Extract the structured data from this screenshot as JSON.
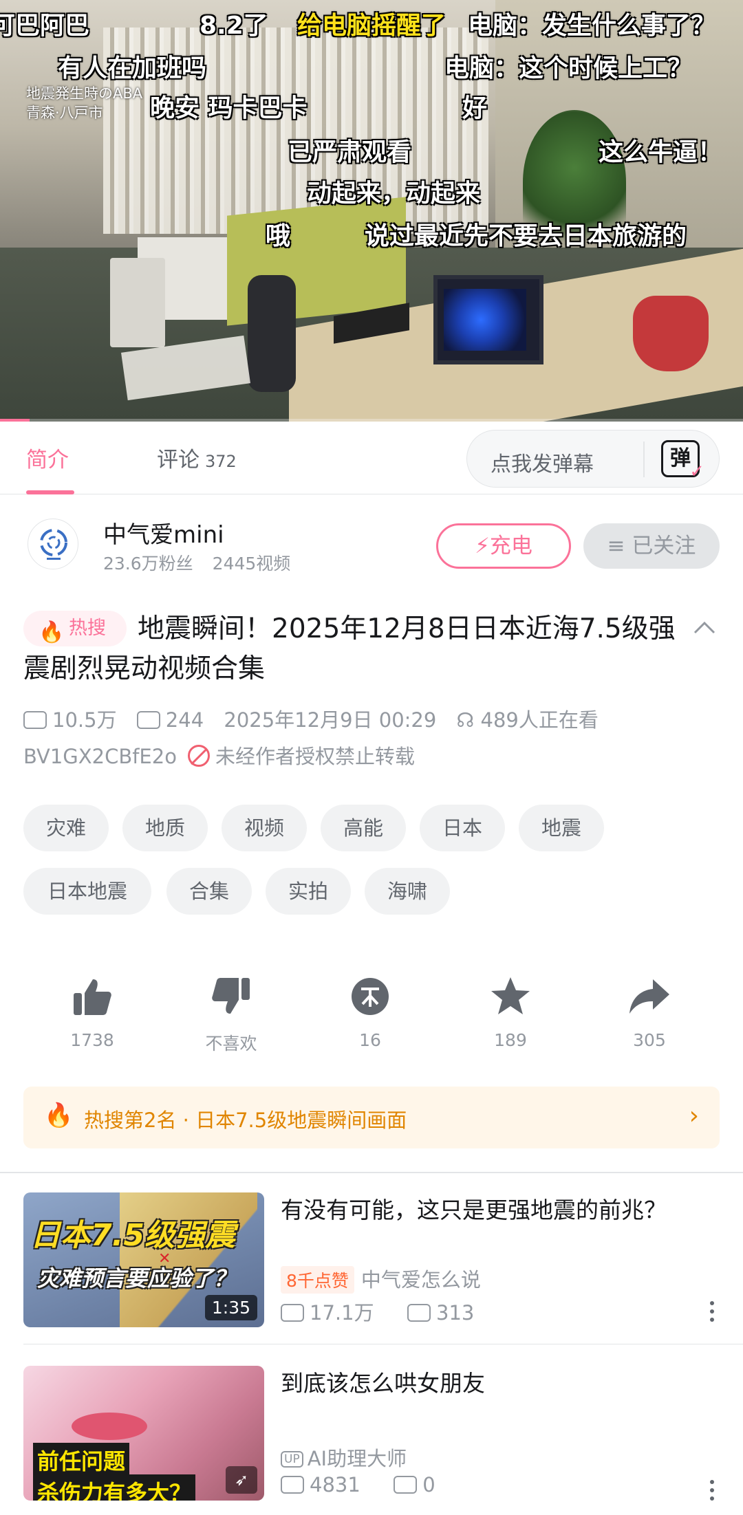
{
  "player": {
    "tv_caption_line1": "地震発生時のABA",
    "tv_caption_line2": "青森·八戸市",
    "danmaku": [
      {
        "text": "可巴阿巴",
        "color": "white"
      },
      {
        "text": "8.2了",
        "color": "white"
      },
      {
        "text": "给电脑摇醒了",
        "color": "yellow"
      },
      {
        "text": "电脑：发生什么事了？",
        "color": "white"
      },
      {
        "text": "有人在加班吗",
        "color": "white"
      },
      {
        "text": "电脑：这个时候上工？",
        "color": "white"
      },
      {
        "text": "晚安 玛卡巴卡",
        "color": "white"
      },
      {
        "text": "好",
        "color": "white"
      },
      {
        "text": "已严肃观看",
        "color": "white"
      },
      {
        "text": "这么牛逼！",
        "color": "white"
      },
      {
        "text": "动起来，动起来",
        "color": "white"
      },
      {
        "text": "哦",
        "color": "white"
      },
      {
        "text": "说过最近先不要去日本旅游的",
        "color": "white"
      }
    ],
    "progress_fraction": 0.04
  },
  "tabs": {
    "intro": "简介",
    "comments": "评论",
    "comments_count": "372",
    "danmu_placeholder": "点我发弹幕",
    "danmu_button": "弹"
  },
  "uploader": {
    "name": "中气爱mini",
    "fans": "23.6万粉丝",
    "videos": "2445视频",
    "charge_label": "充电",
    "follow_label": "已关注"
  },
  "video": {
    "hot_badge": "热搜",
    "title": "地震瞬间！2025年12月8日日本近海7.5级强震剧烈晃动视频合集",
    "views": "10.5万",
    "danmaku_count": "244",
    "date": "2025年12月9日 00:29",
    "watching": "489人正在看",
    "bvid": "BV1GX2CBfE2o",
    "copyright": "未经作者授权禁止转载"
  },
  "tags": [
    "灾难",
    "地质",
    "视频",
    "高能",
    "日本",
    "地震",
    "日本地震",
    "合集",
    "实拍",
    "海啸"
  ],
  "actions": {
    "like": "1738",
    "dislike": "不喜欢",
    "coin": "16",
    "favorite": "189",
    "share": "305"
  },
  "hot_banner": {
    "text": "热搜第2名 · 日本7.5级地震瞬间画面"
  },
  "recommended": [
    {
      "title": "有没有可能，这只是更强地震的前兆？",
      "badge": "8千点赞",
      "author": "中气爱怎么说",
      "views": "17.1万",
      "danmaku": "313",
      "duration": "1:35",
      "thumb_text1": "日本7.5级强震",
      "thumb_text2": "灾难预言要应验了？"
    },
    {
      "title": "到底该怎么哄女朋友",
      "author_tag": "UP",
      "author": "AI助理大师",
      "views": "4831",
      "danmaku": "0",
      "thumb_text1": "前任问题",
      "thumb_text2": "杀伤力有多大？"
    }
  ],
  "colors": {
    "accent": "#fb7299",
    "hot": "#e08500",
    "muted": "#9499a0"
  }
}
